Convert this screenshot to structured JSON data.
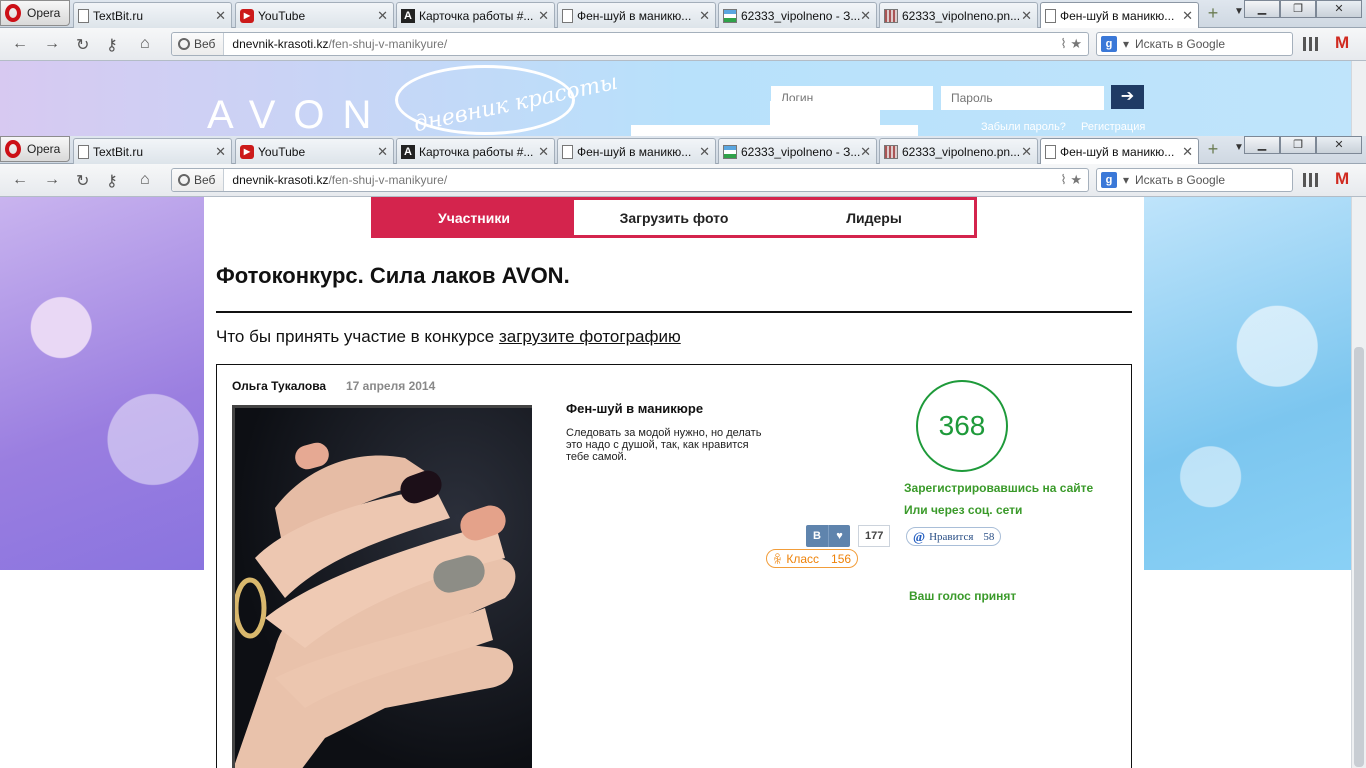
{
  "browser": {
    "opera_label": "Opera",
    "tabs": [
      {
        "title": "TextBit.ru",
        "icon": "page-icon"
      },
      {
        "title": "YouTube",
        "icon": "youtube-icon"
      },
      {
        "title": "Карточка работы #...",
        "icon": "a-letter-icon"
      },
      {
        "title": "Фен-шуй в маникю...",
        "icon": "page-icon"
      },
      {
        "title": "62333_vipolneno - З...",
        "icon": "flag-icon"
      },
      {
        "title": "62333_vipolneno.pn...",
        "icon": "image-icon"
      },
      {
        "title": "Фен-шуй в маникю...",
        "icon": "page-icon"
      }
    ],
    "url_badge": "Веб",
    "url_domain": "dnevnik-krasoti.kz",
    "url_path": "/fen-shuj-v-manikyure/",
    "search_placeholder": "Искать в Google",
    "search_engine_letter": "g"
  },
  "site": {
    "logo_text": "AVON",
    "logo_script": "дневник красоты",
    "login_placeholder": "Логин",
    "password_placeholder": "Пароль",
    "forgot_link": "Забыли пароль?",
    "register_link": "Регистрация"
  },
  "menu": [
    {
      "label": "Участники",
      "active": true
    },
    {
      "label": "Загрузить фото",
      "active": false
    },
    {
      "label": "Лидеры",
      "active": false
    }
  ],
  "page": {
    "title": "Фотоконкурс. Сила лаков AVON.",
    "invite_text": "Что бы принять участие в конкурсе ",
    "invite_link": "загрузите фотографию"
  },
  "entry": {
    "author": "Ольга Тукалова",
    "date": "17 апреля 2014",
    "title": "Фен-шуй в маникюре",
    "description": "Следовать за модой нужно, но делать это надо с душой, так, как нравится тебе самой.",
    "score": "368",
    "register_link": "Зарегистрировавшись на сайте",
    "social_link": "Или через соц. сети",
    "vote_accepted": "Ваш голос принят",
    "vk_letter": "В",
    "vk_count": "177",
    "ok_label": "Класс",
    "ok_count": "156",
    "mm_label": "Нравится",
    "mm_count": "58"
  }
}
